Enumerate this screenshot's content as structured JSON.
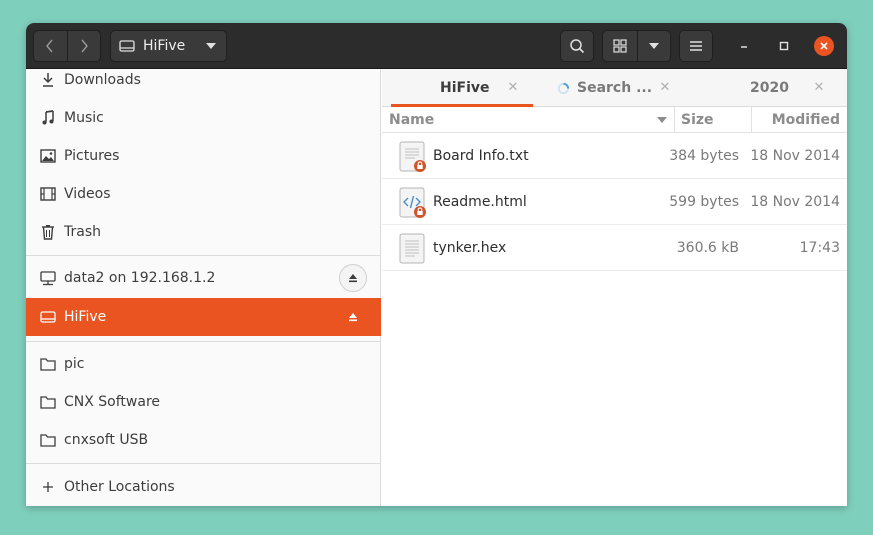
{
  "window": {
    "location_label": "HiFive",
    "accent_color": "#e95420"
  },
  "sidebar": {
    "items": [
      {
        "label": "Downloads",
        "icon": "download-icon"
      },
      {
        "label": "Music",
        "icon": "music-note-icon"
      },
      {
        "label": "Pictures",
        "icon": "picture-icon"
      },
      {
        "label": "Videos",
        "icon": "film-icon"
      },
      {
        "label": "Trash",
        "icon": "trash-icon"
      },
      {
        "label": "data2 on 192.168.1.2",
        "icon": "network-drive-icon"
      },
      {
        "label": "HiFive",
        "icon": "removable-drive-icon",
        "active": true
      },
      {
        "label": "pic",
        "icon": "folder-icon"
      },
      {
        "label": "CNX Software",
        "icon": "folder-icon"
      },
      {
        "label": "cnxsoft USB",
        "icon": "folder-icon"
      },
      {
        "label": "Other Locations",
        "icon": "plus-icon"
      }
    ]
  },
  "tabs": [
    {
      "label": "HiFive",
      "active": true
    },
    {
      "label": "Search ...",
      "loading": true
    },
    {
      "label": "2020"
    }
  ],
  "columns": {
    "name": "Name",
    "size": "Size",
    "modified": "Modified"
  },
  "files": [
    {
      "name": "Board Info.txt",
      "size": "384 bytes",
      "modified": "18 Nov 2014",
      "icon": "text-file-locked-icon"
    },
    {
      "name": "Readme.html",
      "size": "599 bytes",
      "modified": "18 Nov 2014",
      "icon": "html-file-locked-icon"
    },
    {
      "name": "tynker.hex",
      "size": "360.6 kB",
      "modified": "17:43",
      "icon": "text-file-icon"
    }
  ]
}
